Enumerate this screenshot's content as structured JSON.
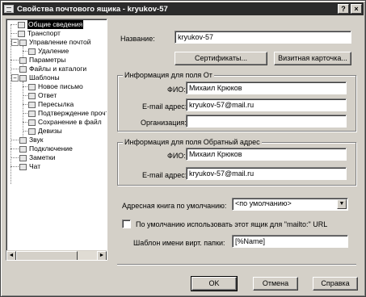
{
  "window": {
    "title": "Свойства почтового ящика - kryukov-57",
    "help_btn": "?",
    "close_btn": "×"
  },
  "tree": {
    "items": [
      {
        "label": "Общие сведения"
      },
      {
        "label": "Транспорт"
      },
      {
        "label": "Управление почтой"
      },
      {
        "label": "Удаление"
      },
      {
        "label": "Параметры"
      },
      {
        "label": "Файлы и каталоги"
      },
      {
        "label": "Шаблоны"
      },
      {
        "label": "Новое письмо"
      },
      {
        "label": "Ответ"
      },
      {
        "label": "Пересылка"
      },
      {
        "label": "Подтверждение прочт"
      },
      {
        "label": "Сохранение в файл"
      },
      {
        "label": "Девизы"
      },
      {
        "label": "Звук"
      },
      {
        "label": "Подключение"
      },
      {
        "label": "Заметки"
      },
      {
        "label": "Чат"
      }
    ],
    "expander_minus": "−",
    "scroll_left": "◄",
    "scroll_right": "►"
  },
  "general": {
    "name_label": "Название:",
    "name_value": "kryukov-57",
    "certificates_btn": "Сертификаты...",
    "business_card_btn": "Визитная карточка..."
  },
  "from_group": {
    "title": "Информация для поля От",
    "fio_label": "ФИО:",
    "fio_value": "Михаил Крюков",
    "email_label": "E-mail адрес:",
    "email_value": "kryukov-57@mail.ru",
    "org_label": "Организация:",
    "org_value": ""
  },
  "reply_group": {
    "title": "Информация для поля Обратный адрес",
    "fio_label": "ФИО:",
    "fio_value": "Михаил Крюков",
    "email_label": "E-mail адрес:",
    "email_value": "kryukov-57@mail.ru"
  },
  "options": {
    "addressbook_label": "Адресная книга по умолчанию:",
    "addressbook_value": "<по умолчанию>",
    "mailto_checkbox_label": "По умолчанию использовать этот ящик для \"mailto:\" URL",
    "mailto_checked": false,
    "template_label": "Шаблон имени вирт. папки:",
    "template_value": "[%Name]"
  },
  "footer": {
    "ok": "OK",
    "cancel": "Отмена",
    "help": "Справка"
  }
}
